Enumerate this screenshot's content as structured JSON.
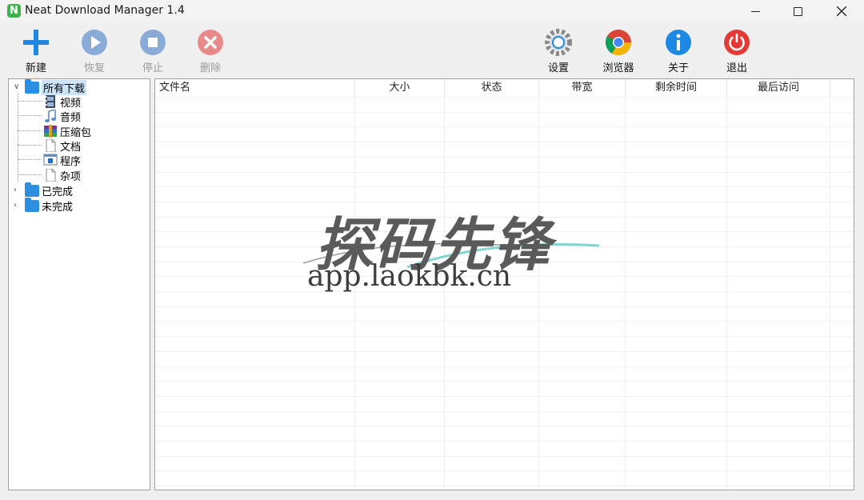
{
  "window": {
    "title": "Neat Download Manager 1.4",
    "app_icon_letter": "N"
  },
  "toolbar": {
    "new_label": "新建",
    "resume_label": "恢复",
    "stop_label": "停止",
    "delete_label": "删除",
    "settings_label": "设置",
    "browser_label": "浏览器",
    "about_label": "关于",
    "exit_label": "退出"
  },
  "tree": {
    "root": "所有下载",
    "children": [
      "视频",
      "音频",
      "压缩包",
      "文档",
      "程序",
      "杂项"
    ],
    "completed": "已完成",
    "incomplete": "未完成"
  },
  "table": {
    "columns": [
      "文件名",
      "大小",
      "状态",
      "带宽",
      "剩余时间",
      "最后访问"
    ]
  },
  "watermark": {
    "text": "探码先锋",
    "url": "app.laokbk.cn"
  },
  "colors": {
    "accent": "#2b8ee0",
    "new_icon": "#1e88e5",
    "exit_icon": "#e53935",
    "disabled_icon": "#8aaad8"
  }
}
